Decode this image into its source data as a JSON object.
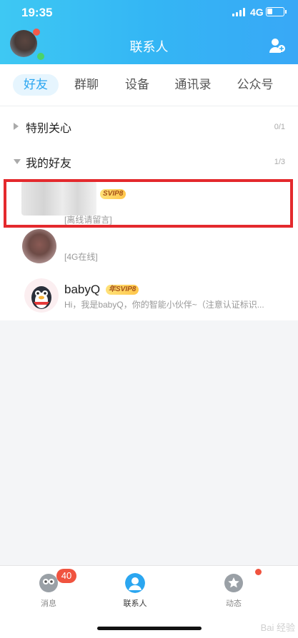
{
  "status": {
    "time": "19:35",
    "network": "4G"
  },
  "header": {
    "title": "联系人"
  },
  "tabs": [
    "好友",
    "群聊",
    "设备",
    "通讯录",
    "公众号"
  ],
  "groups": [
    {
      "name": "特别关心",
      "count": "0/1"
    },
    {
      "name": "我的好友",
      "count": "1/3"
    }
  ],
  "contacts": [
    {
      "name": "",
      "badge": "SVIP8",
      "status": "[离线请留言]"
    },
    {
      "name": "",
      "badge": "",
      "status": "[4G在线]"
    },
    {
      "name": "babyQ",
      "badge": "年SVIP8",
      "status": "Hi，我是babyQ，你的智能小伙伴~（注意认证标识..."
    }
  ],
  "bottom_nav": [
    {
      "label": "消息",
      "badge": "40"
    },
    {
      "label": "联系人",
      "badge": ""
    },
    {
      "label": "动态",
      "badge": ""
    }
  ],
  "colors": {
    "accent": "#2ba6f0",
    "highlight_border": "#e4292d",
    "badge_red": "#f0533f"
  },
  "watermark": "Bai 经验"
}
